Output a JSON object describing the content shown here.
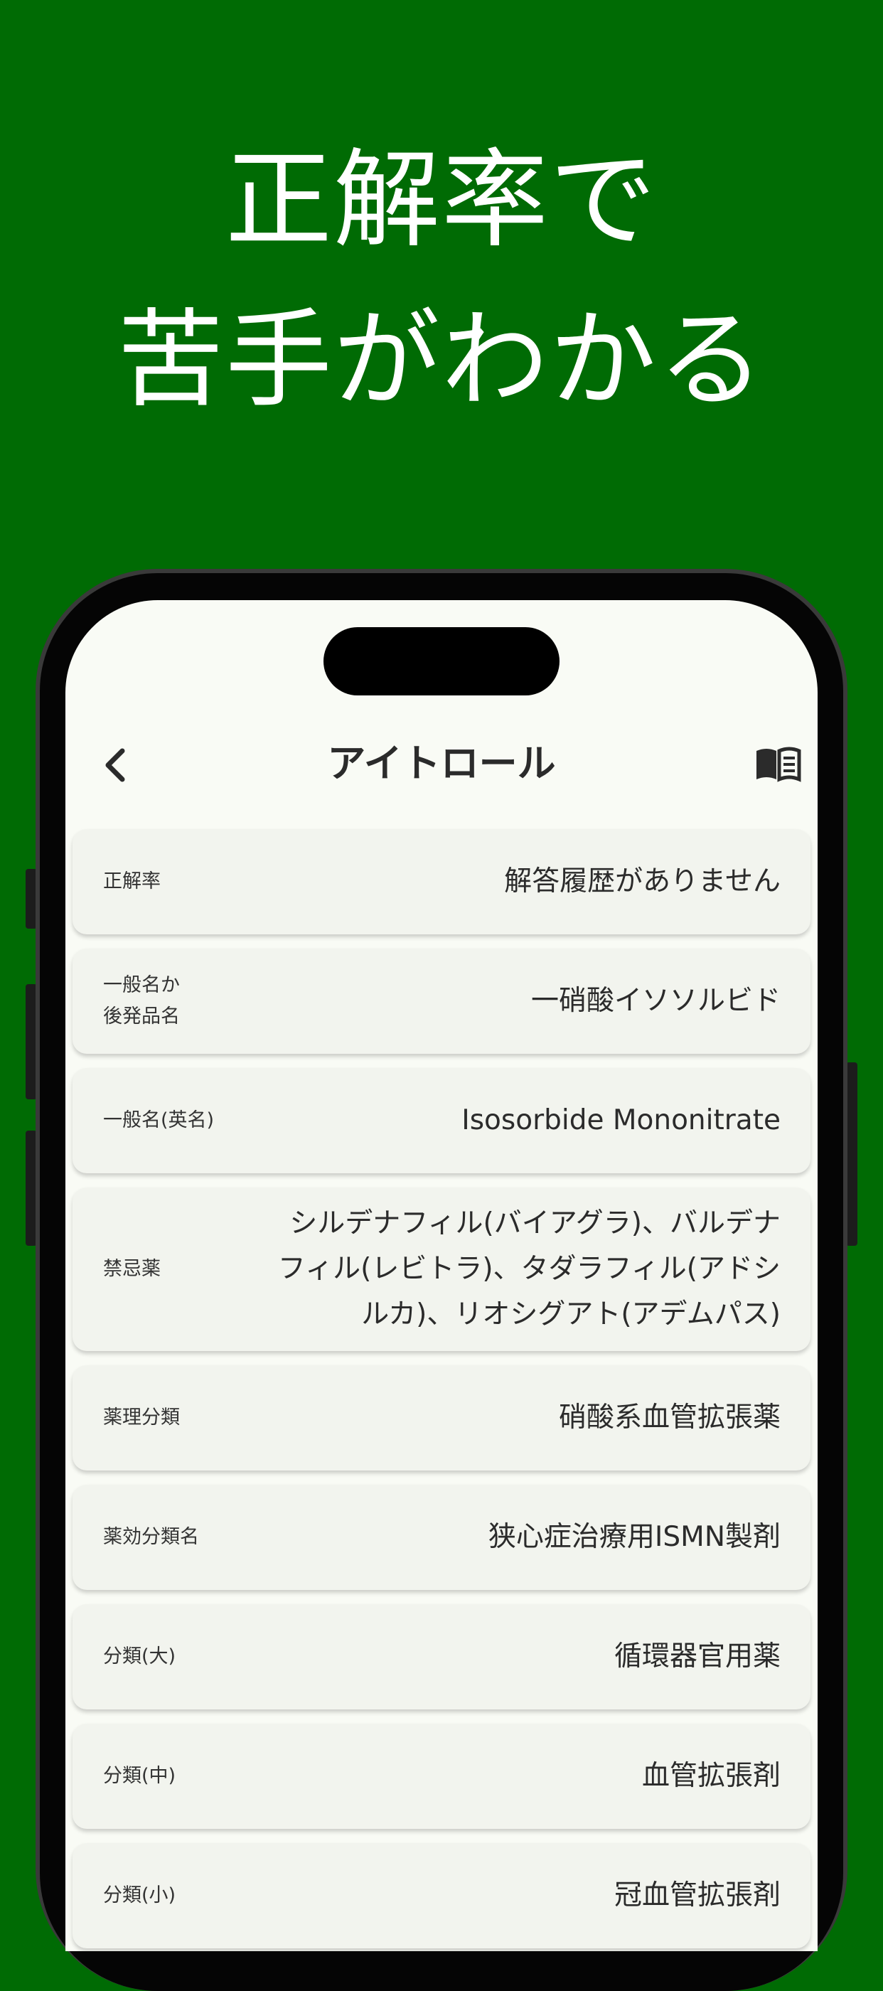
{
  "promo": {
    "line1": "正解率で",
    "line2": "苦手がわかる"
  },
  "nav": {
    "back_icon": "chevron-left-icon",
    "title": "アイトロール",
    "book_icon": "book-open-icon"
  },
  "rows": [
    {
      "label": "正解率",
      "value": "解答履歴がありません"
    },
    {
      "label": "一般名か\n後発品名",
      "value": "一硝酸イソソルビド"
    },
    {
      "label": "一般名(英名)",
      "value": "Isosorbide Mononitrate"
    },
    {
      "label": "禁忌薬",
      "value": "シルデナフィル(バイアグラ)、バルデナ\nフィル(レビトラ)、タダラフィル(アドシ\nルカ)、リオシグアト(アデムパス)"
    },
    {
      "label": "薬理分類",
      "value": "硝酸系血管拡張薬"
    },
    {
      "label": "薬効分類名",
      "value": "狭心症治療用ISMN製剤"
    },
    {
      "label": "分類(大)",
      "value": "循環器官用薬"
    },
    {
      "label": "分類(中)",
      "value": "血管拡張剤"
    },
    {
      "label": "分類(小)",
      "value": "冠血管拡張剤"
    }
  ],
  "colors": {
    "background": "#006b04",
    "screen": "#f9fbf5",
    "card": "#f2f4ee"
  }
}
